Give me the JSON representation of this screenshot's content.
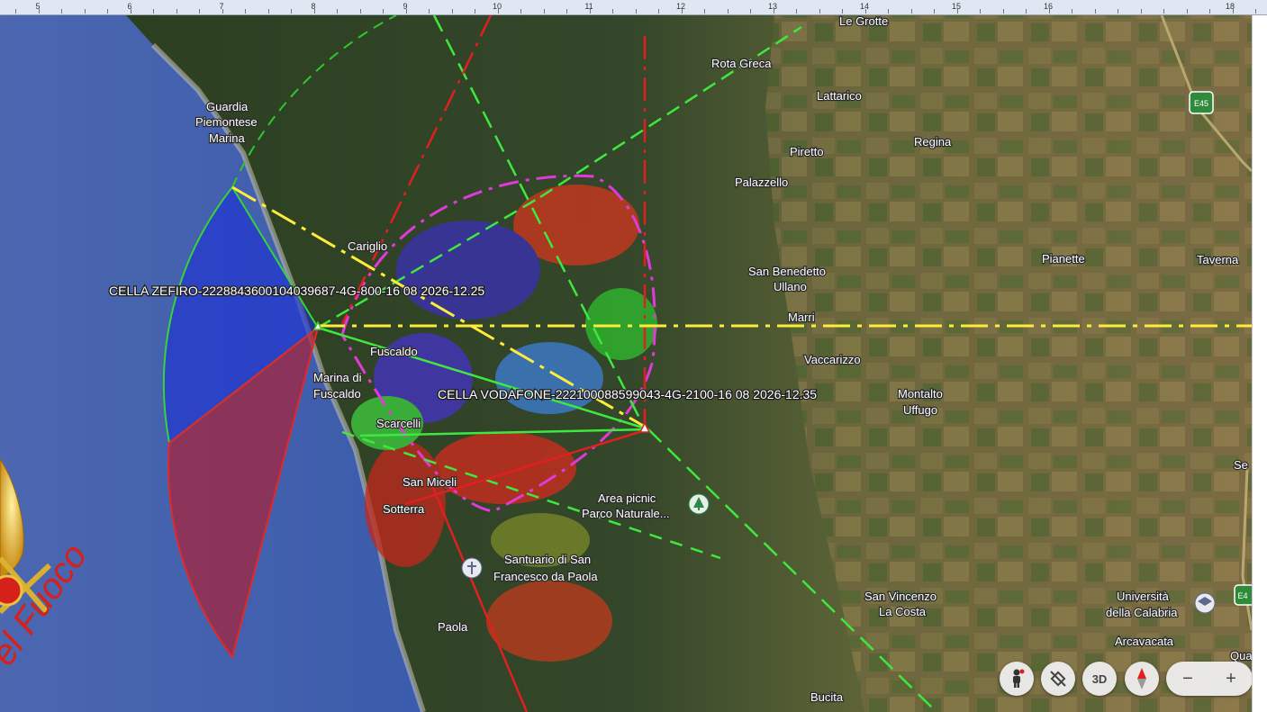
{
  "ruler": {
    "numbers": [
      "5",
      "6",
      "7",
      "8",
      "9",
      "10",
      "11",
      "12",
      "13",
      "14",
      "15",
      "16",
      "18"
    ]
  },
  "places": {
    "le_grotte": "Le Grotte",
    "rota_greca": "Rota Greca",
    "lattarico": "Lattarico",
    "regina": "Regina",
    "piretto": "Piretto",
    "guardia_1": "Guardia",
    "guardia_2": "Piemontese",
    "guardia_3": "Marina",
    "palazzello": "Palazzello",
    "cariglio": "Cariglio",
    "san_benedetto_1": "San Benedetto",
    "san_benedetto_2": "Ullano",
    "pianette": "Pianette",
    "taverna": "Taverna",
    "marri": "Marri",
    "fuscaldo": "Fuscaldo",
    "vaccarizzo": "Vaccarizzo",
    "marina_fuscaldo_1": "Marina di",
    "marina_fuscaldo_2": "Fuscaldo",
    "montalto_1": "Montalto",
    "montalto_2": "Uffugo",
    "scarcelli": "Scarcelli",
    "san_miceli": "San Miceli",
    "sotterra": "Sotterra",
    "area_picnic_1": "Area picnic",
    "area_picnic_2": "Parco Naturale...",
    "santuario_1": "Santuario di San",
    "santuario_2": "Francesco da Paola",
    "san_vincenzo_1": "San Vincenzo",
    "san_vincenzo_2": "La Costa",
    "universita_1": "Università",
    "universita_2": "della Calabria",
    "arcavacata": "Arcavacata",
    "paola": "Paola",
    "bucita": "Bucita",
    "se": "Se",
    "qua": "Qua"
  },
  "road_badges": {
    "e45": "E45",
    "e4": "E4"
  },
  "cells": {
    "zefiro": "CELLA ZEFIRO-222884360010403968​7-4G-800-16 08 2026-12.25",
    "vodafone": "CELLA VODAFONE-222100088599043-4G-2100-16 08 2026-12.35"
  },
  "logo": {
    "text": "el Fuoco"
  },
  "controls": {
    "view_3d": "3D",
    "zoom_out": "−",
    "zoom_in": "+"
  },
  "colors": {
    "sea": "#2f4fa8",
    "land": "#3b4a26",
    "sector_blue": "#1d2fd6",
    "sector_red": "#a8233a",
    "line_green": "#3ee83e",
    "line_yellow": "#ffec3a",
    "line_magenta": "#e03ad8",
    "line_red": "#e02020"
  }
}
